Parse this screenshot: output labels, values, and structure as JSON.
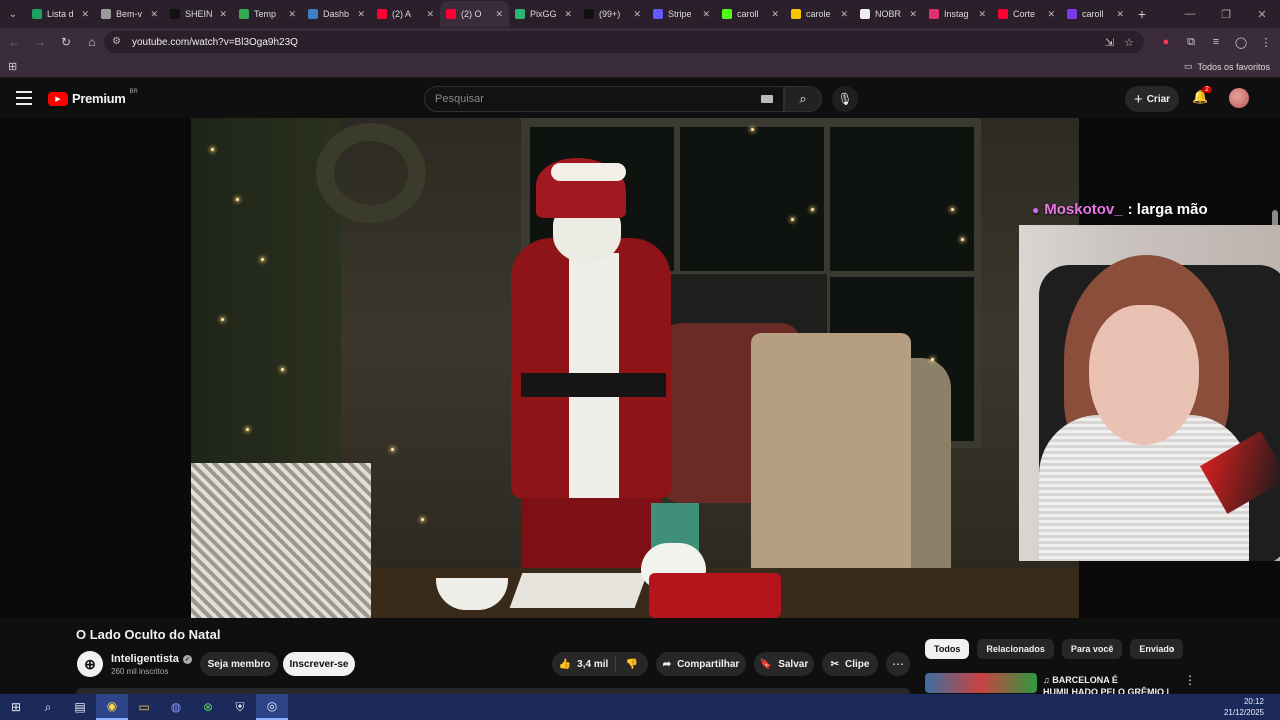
{
  "browser": {
    "tabs": [
      {
        "title": "Lista d",
        "color": "#1ea362"
      },
      {
        "title": "Bem-v",
        "color": "#9b9b9b"
      },
      {
        "title": "SHEIN",
        "color": "#111111"
      },
      {
        "title": "Temp",
        "color": "#34a853"
      },
      {
        "title": "Dashb",
        "color": "#3b82c4"
      },
      {
        "title": "(2) A",
        "color": "#ff0033"
      },
      {
        "title": "(2) O",
        "color": "#ff0033",
        "active": true
      },
      {
        "title": "PixGG",
        "color": "#2bb673"
      },
      {
        "title": "(99+)",
        "color": "#111111"
      },
      {
        "title": "Stripe",
        "color": "#635bff"
      },
      {
        "title": "caroll",
        "color": "#53fc18"
      },
      {
        "title": "carole",
        "color": "#f7c600"
      },
      {
        "title": "NOBR",
        "color": "#eeeeee"
      },
      {
        "title": "Instag",
        "color": "#e1306c"
      },
      {
        "title": "Corte",
        "color": "#ff0033"
      },
      {
        "title": "caroll",
        "color": "#7c3aed"
      }
    ],
    "url": "youtube.com/watch?v=Bl3Oga9h23Q",
    "bookmarks_all": "Todos os favoritos"
  },
  "youtube": {
    "logo_text": "Premium",
    "country_code": "BR",
    "search_placeholder": "Pesquisar",
    "create_label": "Criar",
    "notifications_count": "2"
  },
  "overlay": {
    "chat_user": "Moskotov_",
    "chat_text": ": larga mão"
  },
  "video": {
    "title": "O Lado Oculto do Natal",
    "channel": "Inteligentista",
    "subscribers": "260 mil inscritos",
    "member_label": "Seja membro",
    "subscribe_label": "Inscrever-se",
    "likes": "3,4 mil",
    "share_label": "Compartilhar",
    "save_label": "Salvar",
    "clip_label": "Clipe"
  },
  "sidebar": {
    "chips": [
      "Todos",
      "Relacionados",
      "Para você",
      "Enviado"
    ],
    "rec_title": "♫ BARCELONA É HUMILHADO PELO GRÊMIO | Paródia A Mal"
  },
  "taskbar": {
    "time": "20:12",
    "date": "21/12/2025"
  }
}
